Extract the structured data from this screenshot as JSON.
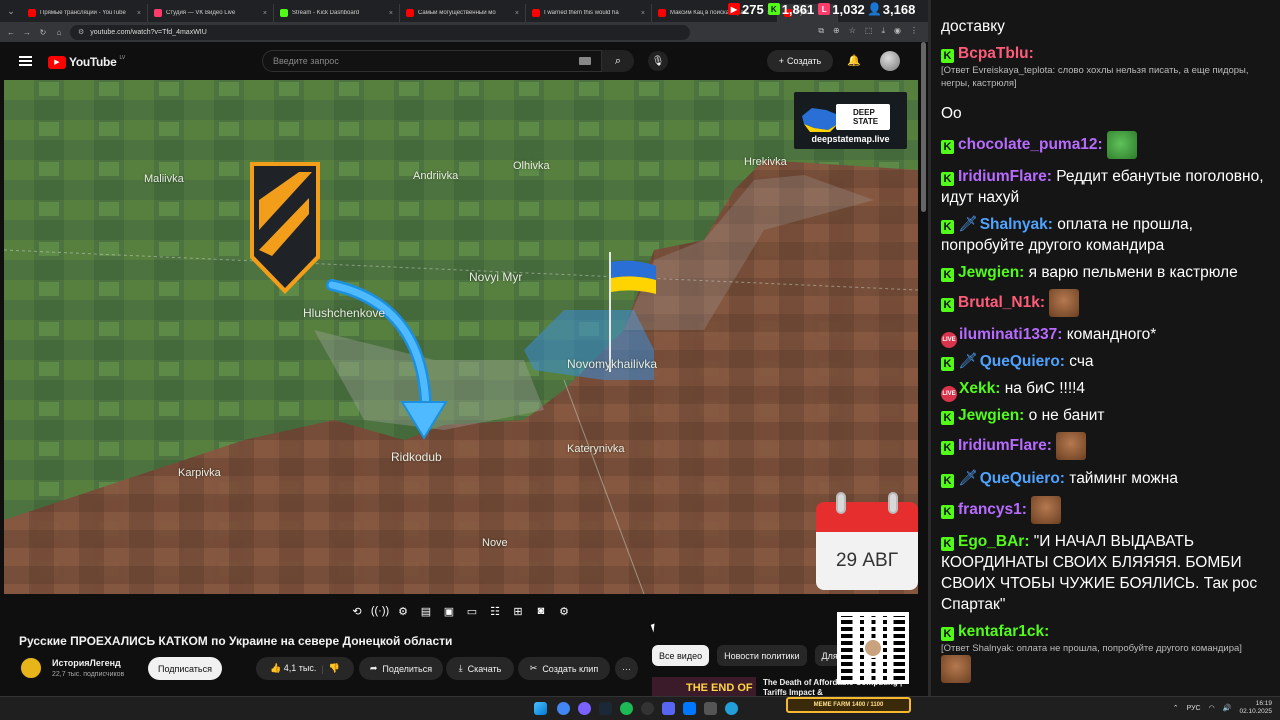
{
  "browser": {
    "tabs": [
      {
        "title": "Прямые трансляции - YouTube",
        "color": "#ff0000"
      },
      {
        "title": "Студия — VK Видео Live",
        "color": "#ff3b6b"
      },
      {
        "title": "Stream - Kick Dashboard",
        "color": "#53fc18"
      },
      {
        "title": "Самый могущественный мо",
        "color": "#ff0000"
      },
      {
        "title": "I warned them this would ha",
        "color": "#ff0000"
      },
      {
        "title": "Максим Кац в поисках прав",
        "color": "#ff0000"
      },
      {
        "title": "Русс",
        "color": "#ff0000"
      }
    ],
    "url": "youtube.com/watch?v=Tfd_4maxWIU"
  },
  "stream_stats": [
    {
      "platform": "youtube",
      "value": "275",
      "color": "#ff0000",
      "icon": "▶"
    },
    {
      "platform": "kick",
      "value": "1,861",
      "color": "#53fc18",
      "icon": "K"
    },
    {
      "platform": "vk-live",
      "value": "1,032",
      "color": "#ff3b6b",
      "icon": "L"
    },
    {
      "platform": "viewers",
      "value": "3,168",
      "color": "#4fa3ff",
      "icon": "●"
    }
  ],
  "youtube": {
    "logo_text": "YouTube",
    "country_code": "LV",
    "search_placeholder": "Введите запрос",
    "create_label": "Создать",
    "video_title": "Русские ПРОЕХАЛИСЬ КАТКОМ по Украине на севере Донецкой области",
    "channel_name": "ИсторияЛегенд",
    "subscribers": "22,7 тыс. подписчиков",
    "subscribe_label": "Подписаться",
    "likes": "4,1 тыс.",
    "share_label": "Поделиться",
    "download_label": "Скачать",
    "clip_label": "Создать клип",
    "more_label": "···",
    "chips": [
      "Все видео",
      "Новости политики",
      "Для"
    ],
    "rec_thumb_text": "THE END OF",
    "rec_title": "The Death of Affordable Computing | Tariffs Impact &"
  },
  "map": {
    "labels": [
      "Maliivka",
      "Andriivka",
      "Olhivka",
      "Hrekivka",
      "Novyi Myr",
      "Hlushchenkove",
      "Novomykhailivka",
      "Ridkodub",
      "Katerynivka",
      "Karpivka",
      "Nove"
    ],
    "brand_text": "deepstatemap.live",
    "brand_logo_text": "DEEP STATE",
    "date": "29 АВГ"
  },
  "chat": {
    "messages": [
      {
        "name": "",
        "text": "доставку",
        "color": "#ffffff"
      },
      {
        "name": "BcpaTblu:",
        "text": "",
        "reply": "[Ответ Evreiskaya_teplota: слово хохлы нельзя писать, а еще пидоры, негры, кастрюля]",
        "color": "#ff5c7a"
      },
      {
        "name": "",
        "text": "Oo",
        "color": "#ffffff"
      },
      {
        "name": "chocolate_puma12:",
        "text": "",
        "color": "#b76bff"
      },
      {
        "name": "IridiumFlare:",
        "text": "Реддит ебанутые поголовно, идут нахуй",
        "color": "#b76bff"
      },
      {
        "name": "Shalnyak:",
        "text": "оплата не прошла, попробуйте другого командира",
        "color": "#4fa3ff"
      },
      {
        "name": "Jewgien:",
        "text": "я варю пельмени в кастрюле",
        "color": "#53fc18"
      },
      {
        "name": "Brutal_N1k:",
        "text": "",
        "color": "#ff5c7a"
      },
      {
        "name": "iluminati1337:",
        "text": "командного*",
        "color": "#b76bff"
      },
      {
        "name": "QueQuiero:",
        "text": "сча",
        "color": "#4fa3ff"
      },
      {
        "name": "Xekk:",
        "text": "на биС !!!!4",
        "color": "#53fc18"
      },
      {
        "name": "Jewgien:",
        "text": "о не банит",
        "color": "#53fc18"
      },
      {
        "name": "IridiumFlare:",
        "text": "",
        "color": "#b76bff"
      },
      {
        "name": "QueQuiero:",
        "text": "тайминг можна",
        "color": "#4fa3ff"
      },
      {
        "name": "francys1:",
        "text": "",
        "color": "#b76bff"
      },
      {
        "name": "Ego_BAr:",
        "text": "\"И НАЧАЛ ВЫДАВАТЬ КООРДИНАТЫ СВОИХ БЛЯЯЯЯ. БОМБИ СВОИХ ЧТОБЫ ЧУЖИЕ БОЯЛИСЬ. Так рос Спартак\"",
        "color": "#53fc18"
      },
      {
        "name": "kentafar1ck:",
        "text": "",
        "reply": "[Ответ Shalnyak: оплата не прошла, попробуйте другого командира]",
        "color": "#53fc18"
      }
    ]
  },
  "taskbar": {
    "gamebar_text": "MEME FARM 1400 / 1100",
    "lang": "РУС",
    "time": "16:19",
    "date": "02.10.2025"
  }
}
